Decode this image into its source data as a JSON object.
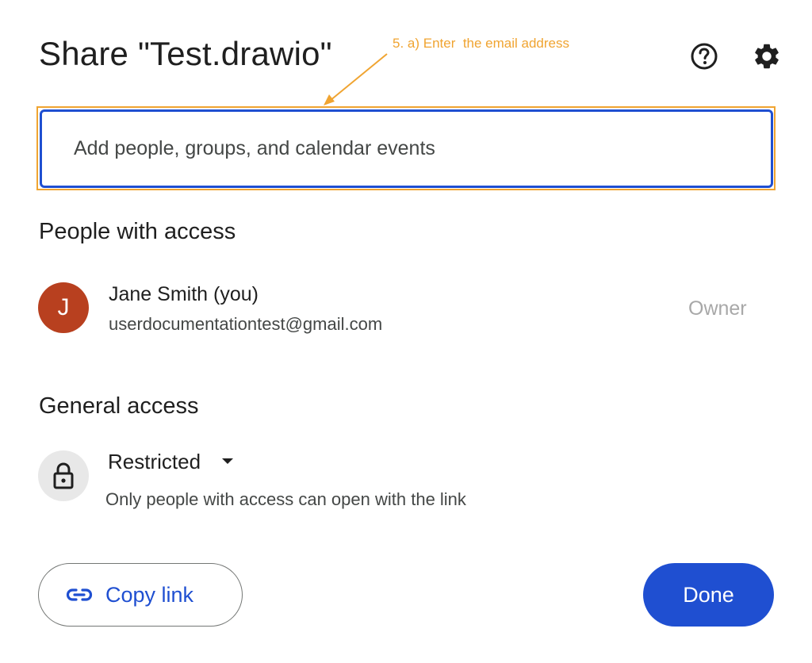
{
  "dialog": {
    "title": "Share \"Test.drawio\"",
    "annotation": "5. a) Enter  the email address",
    "help_icon": "help-circle-icon",
    "settings_icon": "gear-icon"
  },
  "search": {
    "placeholder": "Add people, groups, and calendar events",
    "value": ""
  },
  "people_section": {
    "heading": "People with access",
    "people": [
      {
        "avatar_initial": "J",
        "name": "Jane Smith (you)",
        "email": "userdocumentationtest@gmail.com",
        "role": "Owner"
      }
    ]
  },
  "general_access": {
    "heading": "General access",
    "selected": "Restricted",
    "description": "Only people with access can open with the link",
    "icon": "lock-icon"
  },
  "footer": {
    "copy_link_label": "Copy link",
    "copy_link_icon": "link-icon",
    "done_label": "Done"
  },
  "colors": {
    "accent": "#1f4fd1",
    "annotation": "#f0a431",
    "avatar": "#b8401f",
    "owner_text": "#a8a8a8"
  }
}
